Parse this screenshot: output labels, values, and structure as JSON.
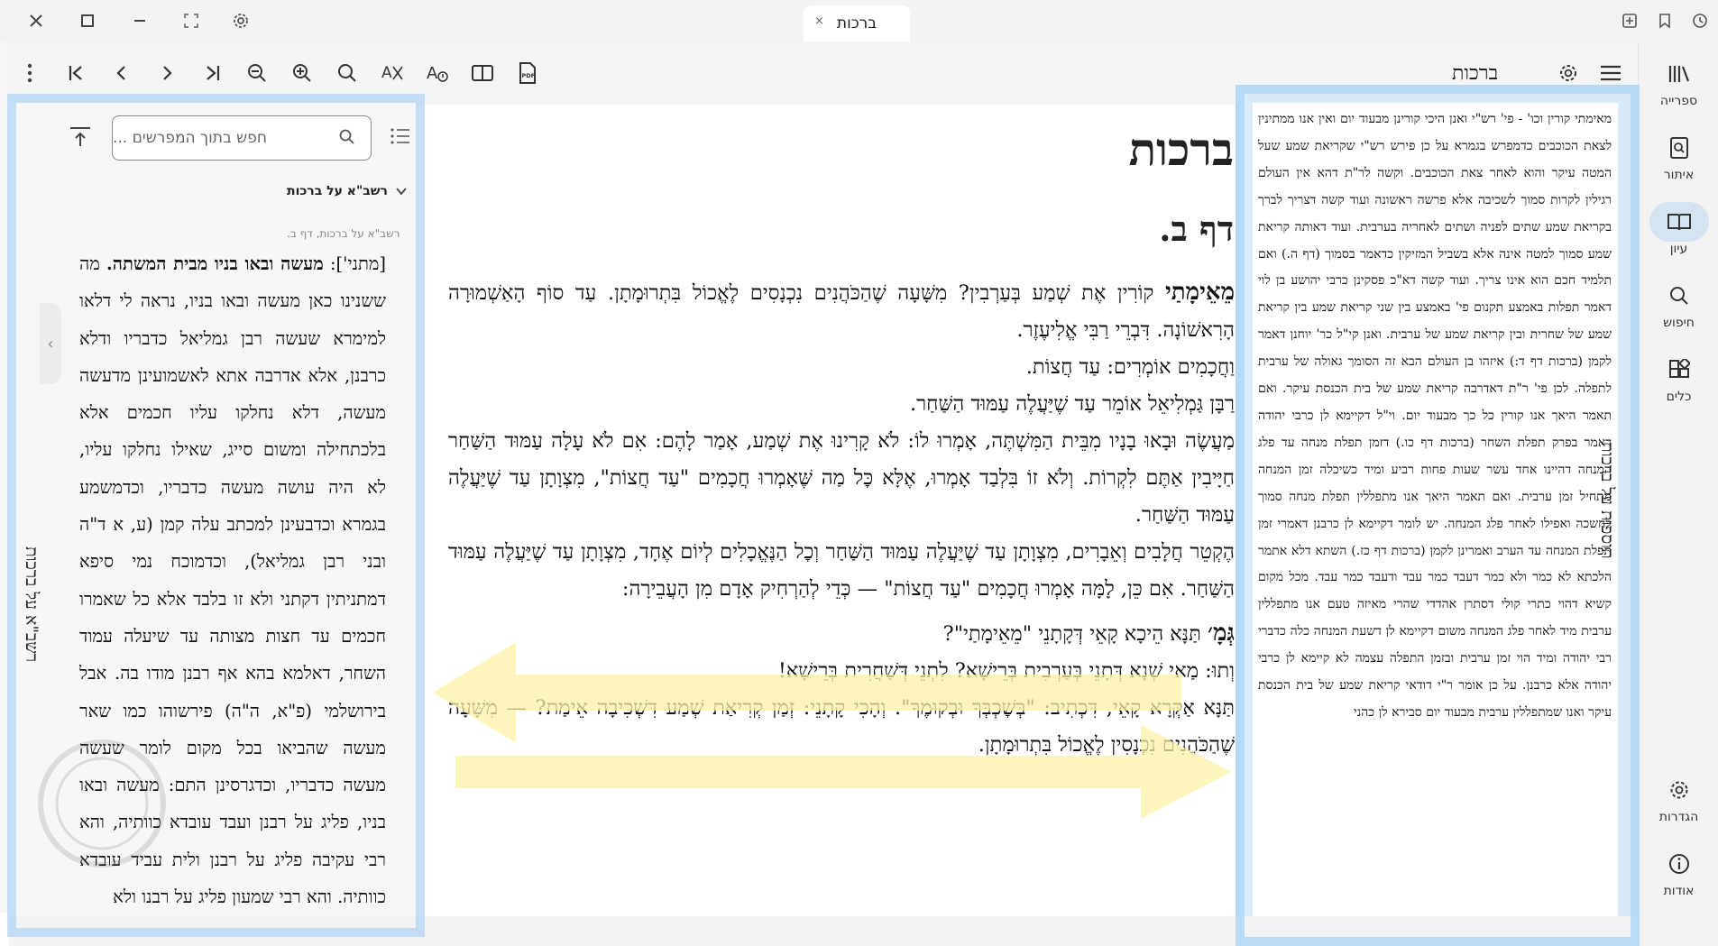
{
  "titlebar": {
    "tab_title": "ברכות",
    "tab_close": "×"
  },
  "toolbar": {
    "breadcrumb": "ברכות"
  },
  "nav": {
    "items": [
      {
        "label": "ספרייה",
        "icon": "library-icon"
      },
      {
        "label": "איתור",
        "icon": "locate-icon"
      },
      {
        "label": "עיון",
        "icon": "book-open-icon",
        "active": true
      },
      {
        "label": "חיפוש",
        "icon": "search-icon"
      },
      {
        "label": "כלים",
        "icon": "tools-icon"
      },
      {
        "label": "הגדרות",
        "icon": "gear-icon"
      },
      {
        "label": "אודות",
        "icon": "info-icon"
      }
    ]
  },
  "commentary": {
    "search_placeholder": "חפש בתוך המפרשים ...",
    "group_header": "רשב\"א על ברכות",
    "source": "רשב\"א על ברכות, דף ב.",
    "vertical_title": "רשב\"א על ברכות",
    "text_lead": "[מתני']: ",
    "text_bold": "מעשה ובאו בניו מבית המשתה.",
    "text_body": " מה ששנינו כאן מעשה ובאו בניו, נראה לי דלאו למימרא שעשה רבן גמליאל כדבריו ודלא כרבנן, אלא אדרבה אתא לאשמועינן מדעשה מעשה, דלא נחלקו עליו חכמים אלא בלכתחילה ומשום סייג, שאילו נחלקו עליו, לא היה עושה מעשה כדבריו, וכדמשמע בגמרא וכדבעינן למכתב עלה קמן (ע, א ד\"ה ובני רבן גמליאל), וכדמוכח נמי סיפא דמתניתין דקתני ולא זו בלבד אלא כל שאמרו חכמים עד חצות מצותה עד שיעלה עמוד השחר, דאלמא בהא אף רבנן מודו בה. אבל בירושלמי (פ\"א, ה\"ה) פירשוהו כמו שאר מעשה שהביאו בכל מקום לומר שעשה מעשה כדבריו, וכדגרסינן התם: מעשה ובאו בניו, פליג על רבנן ועבד עובדא כוותיה, והא רבי עקיבה פליג על רבנן ולית עביד עובדא כוותיה. והא רבי שמעון פליג על רבנו ולא"
  },
  "main": {
    "title": "ברכות",
    "daf": "דף ב.",
    "p1_bold": "מֵאֵימָתַי",
    "p1_text": " קוֹרִין אֶת שְׁמַע בְּעַרְבִין? מִשָּׁעָה שֶׁהַכֹּהֲנִים נִכְנָסִים לֶאֱכוֹל בִּתְרוּמָתָן. עַד סוֹף הָאַשְׁמוּרָה הָרִאשׁוֹנָה. דִּבְרֵי רַבִּי אֱלִיעֶזֶר.",
    "p2": "וַחֲכָמִים אוֹמְרִים: עַד חֲצוֹת.",
    "p3": "רַבָּן גַּמְלִיאֵל אוֹמֵר עַד שֶׁיַּעֲלֶה עַמּוּד הַשַּׁחַר.",
    "p4": "מַעֲשֶׂה וּבָאוּ בָנָיו מִבֵּית הַמִּשְׁתֶּה, אָמְרוּ לוֹ: לֹא קָרִינוּ אֶת שְׁמַע, אָמַר לָהֶם: אִם לֹא עָלָה עַמּוּד הַשַּׁחַר חַיָּיבִין אַתֶּם לִקְרוֹת. וְלֹא זוֹ בִּלְבַד אָמְרוּ, אֶלָּא כׇּל מַה שֶּׁאָמְרוּ חֲכָמִים \"עַד חֲצוֹת\", מִצְוָתָן עַד שֶׁיַּעֲלֶה עַמּוּד הַשַּׁחַר.",
    "p5": "הֶקְטֵר חֲלָבִים וְאֵבָרִים, מִצְוָתָן עַד שֶׁיַּעֲלֶה עַמּוּד הַשַּׁחַר וְכׇל הַנֶּאֱכָלִים לְיוֹם אֶחָד, מִצְוָתָן עַד שֶׁיַּעֲלֶה עַמּוּד הַשַּׁחַר. אִם כֵּן, לָמָּה אָמְרוּ חֲכָמִים \"עַד חֲצוֹת\" — כְּדֵי לְהַרְחִיק אָדָם מִן הָעֲבֵירָה:",
    "p6_bold": "גְּמָ׳",
    "p6_text": " תַּנָּא הֵיכָא קָאֵי דְּקָתָנֵי \"מֵאֵימָתַי\"?",
    "p7": "וְתוּ: מַאי שְׁנָא דְּתָנֵי בְּעַרְבִית בְּרֵישָׁא? לִתְנֵי דְּשַׁחֲרִית בְּרֵישָׁא!",
    "p8": "תַּנָּא אַקְּרָא קָאֵי, דִּכְתִיב: \"בְּשׇׁכְבְּךָ וּבְקוּמֶךָ\". וְהָכִי קָתָנֵי: זְמַן קְרִיאַת שְׁמַע דִּשְׁכִיבָה אֵימַת? — מִשָּׁעָה שֶׁהַכֹּהֲנִים נִכְנָסִין לֶאֱכוֹל בִּתְרוּמָתָן."
  },
  "tosafot": {
    "vertical_title": "תוספות על ברכות",
    "text": "מאימתי קורין וכו' - פי' רש\"י ואנן היכי קורינן מבעוד יום ואין אנו ממתינין לצאת הכוכבים כדמפרש בגמרא על כן פירש רש\"י שקריאת שמע שעל המטה עיקר והוא לאחר צאת הכוכבים. וקשה לר\"ת דהא אין העולם רגילין לקרות סמוך לשכיבה אלא פרשה ראשונה ועוד קשה דצריך לברך בקריאת שמע שתים לפניה ושתים לאחריה בערבית. ועוד דאותה קריאת שמע סמוך למטה אינה אלא בשביל המזיקין כדאמר בסמוך (דף ה.) ואם תלמיד חכם הוא אינו צריך. ועוד קשה דא\"כ פסקינן כרבי יהושע בן לוי דאמר תפלות באמצע תקנום פי' באמצע בין שני קריאת שמע בין קריאת שמע של שחרית ובין קריאת שמע של ערבית. ואנן קי\"ל כר' יוחנן דאמר לקמן (ברכות דף ד:) איזהו בן העולם הבא זה הסומך גאולה של ערבית לתפלה. לכן פי' ר\"ת דאדרבה קריאת שמע של בית הכנסת עיקר. ואם תאמר היאך אנו קורין כל כך מבעוד יום. וי\"ל דקיימא לן כרבי יהודה דאמר בפרק תפלת השחר (ברכות דף כו.) דזמן תפלת מנחה עד פלג המנחה דהיינו אחד עשר שעות פחות רביע ומיד כשיכלה זמן המנחה מתחיל זמן ערבית. ואם תאמר היאך אנו מתפללין תפלת מנחה סמוך לחשכה ואפילו לאחר פלג המנחה. יש לומר דקיימא לן כרבנן דאמרי זמן תפלת המנחה עד הערב ואמרינן לקמן (ברכות דף כז.) השתא דלא אתמר הלכתא לא כמר ולא כמר דעבד כמר עבד ודעבד כמר עבד. מכל מקום קשיא דהוי כתרי קולי דסתרן אהדדי שהרי מאיזה טעם אנו מתפללין ערבית מיד לאחר פלג המנחה משום דקיימא לן דשעת המנחה כלה כדברי רבי יהודה ומיד הוי זמן ערבית ובזמן התפלה עצמה לא קיימא לן כרבי יהודה אלא כרבנן. על כן אומר ר\"י דודאי קריאת שמע של בית הכנסת עיקר ואנו שמתפללין ערבית מבעוד יום סבירא לן כהני"
  },
  "colors": {
    "frame_highlight": "#afd6f5",
    "arrow_highlight": "#fbf1a6",
    "nav_active_bg": "#d6e3f2"
  }
}
